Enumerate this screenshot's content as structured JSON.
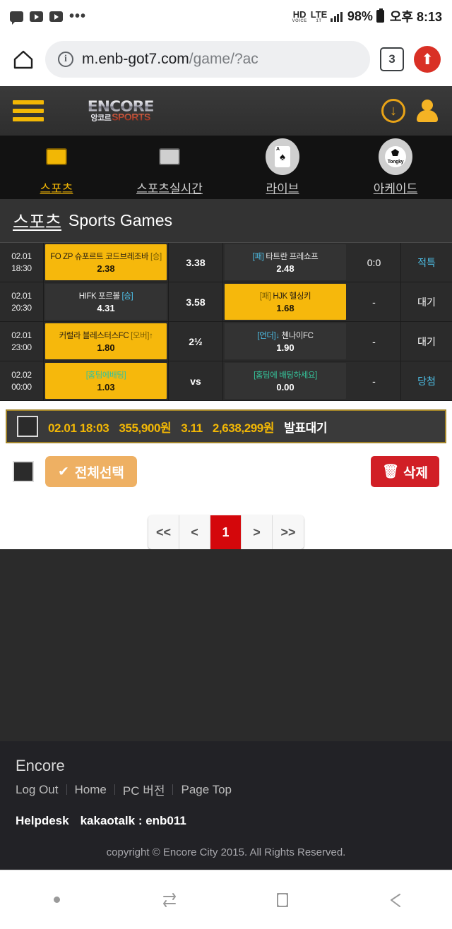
{
  "status_bar": {
    "icons": [
      "chat-icon",
      "youtube-icon",
      "youtube-icon",
      "more-icon"
    ],
    "hd_label": "HD",
    "hd_sub": "VOICE",
    "lte_label": "LTE",
    "lte_sub": "1T",
    "battery_pct": "98%",
    "clock": "오후 8:13"
  },
  "browser": {
    "url_main": "m.enb-got7.com",
    "url_path": "/game/?ac",
    "tab_count": "3"
  },
  "site_header": {
    "logo_main": "ENCORE",
    "logo_ko": "앙코르",
    "logo_sports": "SPORTS"
  },
  "category_tabs": [
    {
      "label": "스포츠",
      "icon": "folder-open-icon",
      "active": true
    },
    {
      "label": "스포츠실시간",
      "icon": "folder-icon",
      "active": false
    },
    {
      "label": "라이브",
      "icon": "playing-card-icon",
      "active": false
    },
    {
      "label": "아케이드",
      "icon": "soccer-ball-icon",
      "active": false
    }
  ],
  "page_title": {
    "ko": "스포츠",
    "en": "Sports Games"
  },
  "bet_rows": [
    {
      "date": "02.01",
      "time": "18:30",
      "home": {
        "tag": "",
        "tag_color": "",
        "name": "FO ZP 슈포르트 코드브레조바",
        "suffix": "[승]",
        "odds": "2.38",
        "selected": true
      },
      "mid": "3.38",
      "away": {
        "tag": "[패]",
        "tag_color": "#4ec0e8",
        "name": "타트란 프레쇼프",
        "suffix": "",
        "odds": "2.48",
        "selected": false
      },
      "score": "0:0",
      "status": "적특",
      "status_plain": false
    },
    {
      "date": "02.01",
      "time": "20:30",
      "home": {
        "tag": "",
        "tag_color": "",
        "name": "HIFK 포르볼",
        "suffix": "[승]",
        "odds": "4.31",
        "selected": false
      },
      "mid": "3.58",
      "away": {
        "tag": "[패]",
        "tag_color": "#7a5e00",
        "name": "HJK 헬싱키",
        "suffix": "",
        "odds": "1.68",
        "selected": true
      },
      "score": "-",
      "status": "대기",
      "status_plain": true
    },
    {
      "date": "02.01",
      "time": "23:00",
      "home": {
        "tag": "",
        "tag_color": "",
        "name": "커럴라 블레스터스FC",
        "suffix": "[오버]↑",
        "odds": "1.80",
        "selected": true
      },
      "mid": "2½",
      "away": {
        "tag": "[언더]↓",
        "tag_color": "#4ec0e8",
        "name": "첸나이FC",
        "suffix": "",
        "odds": "1.90",
        "selected": false
      },
      "score": "-",
      "status": "대기",
      "status_plain": true
    },
    {
      "date": "02.02",
      "time": "00:00",
      "home": {
        "tag": "",
        "tag_color": "",
        "name": "[홈팀에배팅]",
        "suffix": "",
        "odds": "1.03",
        "selected": true
      },
      "mid": "vs",
      "away": {
        "tag": "",
        "tag_color": "#35c39a",
        "name": "[홈팀에 배팅하세요]",
        "suffix": "",
        "odds": "0.00",
        "selected": false
      },
      "score": "-",
      "status": "당첨",
      "status_plain": false
    }
  ],
  "summary": {
    "datetime": "02.01 18:03",
    "stake": "355,900원",
    "odds": "3.11",
    "payout": "2,638,299원",
    "status": "발표대기"
  },
  "actions": {
    "select_all": "전체선택",
    "select_all_icon": "check-icon",
    "delete": "삭제",
    "delete_icon": "trash-icon"
  },
  "pagination": {
    "first": "<<",
    "prev": "<",
    "current": "1",
    "next": ">",
    "last": ">>"
  },
  "footer": {
    "brand": "Encore",
    "links": [
      "Log Out",
      "Home",
      "PC 버전",
      "Page Top"
    ],
    "helpdesk_label": "Helpdesk",
    "helpdesk_value": "kakaotalk : enb011",
    "copyright": "copyright © Encore City 2015. All Rights Reserved."
  },
  "android_nav": [
    "dot-indicator",
    "recents-icon",
    "home-icon",
    "back-icon"
  ],
  "colors": {
    "accent_yellow": "#f6b80c",
    "header_yellow": "#f2b705",
    "danger_red": "#d11f26",
    "page_active_red": "#d4070b",
    "cyan_tag": "#4ec0e8",
    "bg_dark": "#2b2b2b",
    "footer_bg": "#222226"
  }
}
